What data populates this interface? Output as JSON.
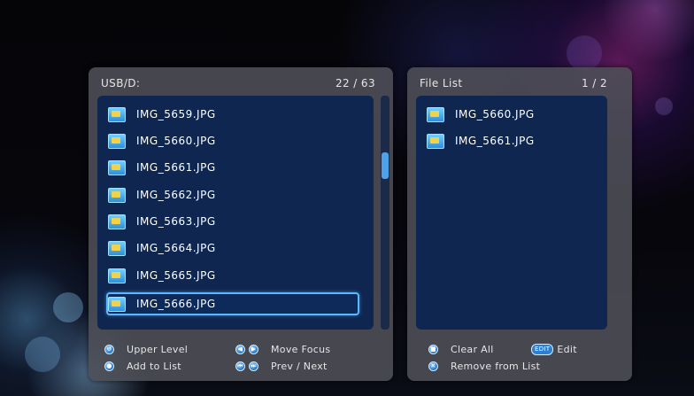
{
  "left_panel": {
    "title": "USB/D:",
    "counter": "22 / 63",
    "files": [
      "IMG_5659.JPG",
      "IMG_5660.JPG",
      "IMG_5661.JPG",
      "IMG_5662.JPG",
      "IMG_5663.JPG",
      "IMG_5664.JPG",
      "IMG_5665.JPG",
      "IMG_5666.JPG"
    ],
    "selected_file": "IMG_5666.JPG",
    "legend": {
      "upper_level": "Upper Level",
      "add_to_list": "Add to List",
      "move_focus": "Move Focus",
      "prev_next": "Prev / Next"
    }
  },
  "right_panel": {
    "title": "File List",
    "counter": "1 / 2",
    "files": [
      "IMG_5660.JPG",
      "IMG_5661.JPG"
    ],
    "legend": {
      "clear_all": "Clear All",
      "edit_badge": "EDIT",
      "edit": "Edit",
      "remove_from_list": "Remove from List"
    }
  },
  "colors": {
    "accent": "#4ea2e8",
    "list_bg": "#0e2650",
    "panel_bg": "#4e5058",
    "selection_border": "#5ab8ff"
  },
  "icons": [
    "image-file-icon",
    "remote-button-icon"
  ]
}
